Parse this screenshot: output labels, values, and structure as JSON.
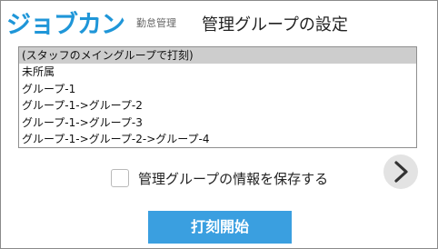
{
  "header": {
    "logo_text": "ジョブカン",
    "logo_subtitle": "勤怠管理",
    "title": "管理グループの設定"
  },
  "group_list": {
    "options": [
      "(スタッフのメイングループで打刻)",
      "未所属",
      "グループ-1",
      "グループ-1->グループ-2",
      "グループ-1->グループ-3",
      "グループ-1->グループ-2->グループ-4"
    ],
    "selected_index": 0
  },
  "save_checkbox": {
    "label": "管理グループの情報を保存する",
    "checked": false
  },
  "next_button": {
    "icon": "chevron-right-icon"
  },
  "start_button": {
    "label": "打刻開始"
  },
  "colors": {
    "brand": "#1f96d8",
    "primary_button": "#3a9fe0",
    "selected_option": "#cdcdcd"
  }
}
